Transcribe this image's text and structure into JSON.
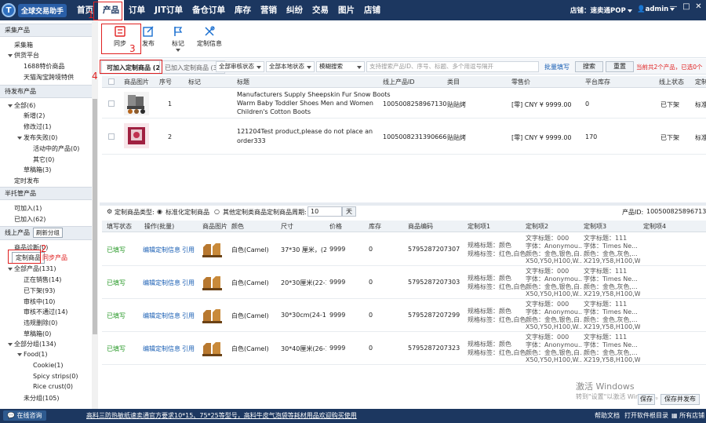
{
  "header": {
    "logo_text": "全球交易助手",
    "logo_letter": "T",
    "nav": [
      "首页",
      "产品",
      "订单",
      "JIT订单",
      "备仓订单",
      "库存",
      "营销",
      "纠纷",
      "交易",
      "图片",
      "店铺"
    ],
    "store_label": "店铺：",
    "store_name": "速卖通POP",
    "user": "admin",
    "win_min": "—",
    "win_max": "□",
    "win_close": "✕"
  },
  "sidebar": {
    "sec1": "采集产品",
    "collect": "采集箱",
    "supply": "供货平台",
    "s1688": "1688特价商品",
    "tmall": "天猫淘宝跨境特供",
    "sec2": "待发布产品",
    "all": "全部(6)",
    "new": "新增(2)",
    "modified": "修改过(1)",
    "pubfail": "发布失败(0)",
    "active_fail": "活动中的产品(0)",
    "other": "其它(0)",
    "draft": "草稿箱(3)",
    "scheduled": "定时发布",
    "sec3": "半托管产品",
    "can_join": "可加入(1)",
    "joined": "已加入(62)",
    "sec4": "线上产品",
    "refresh": "刷新分组",
    "diagnose": "商品诊断(0)",
    "custom": "定制商品",
    "sync_prod": "同步产品",
    "allprod": "全部产品(131)",
    "onsale": "正在销售(14)",
    "offshelf": "已下架(93)",
    "reviewing": "审核中(10)",
    "rejected": "审核不通过(14)",
    "illegal": "违规删除(0)",
    "draft2": "草稿箱(0)",
    "allgroup": "全部分组(134)",
    "food": "Food(1)",
    "cookie": "Cookie(1)",
    "spicy": "Spicy strips(0)",
    "rice": "Rice crust(0)",
    "ungrouped": "未分组(105)"
  },
  "toolbar": {
    "sync": "同步",
    "publish": "发布",
    "mark": "标记",
    "custom_info": "定制信息"
  },
  "filters": {
    "tab1": "可加入定制商品 (2)",
    "tab2": "已加入定制商品 (3)",
    "audit": "全部审核状态",
    "local": "全部本地状态",
    "fuzzy": "模糊搜索",
    "search_placeholder": "支持搜索产品ID、序号、标题、多个用逗号隔开",
    "batch": "批量填写",
    "search_btn": "搜索",
    "reset_btn": "重置",
    "count_note": "当前共2个产品，已选0个"
  },
  "top_table": {
    "headers": [
      "商品图片",
      "序号",
      "标记",
      "标题",
      "线上产品ID",
      "类目",
      "零售价",
      "平台库存",
      "线上状态",
      "定制"
    ],
    "rows": [
      {
        "idx": "1",
        "title1": "Manufacturers Supply Sheepskin Fur Snow Boots",
        "title2": "Warm Baby Toddler Shoes Men and Women",
        "title3": "Children's Cotton Boots",
        "pid": "1005008258967130",
        "cat": "贴贴烤",
        "price": "[零] CNY ¥ 9999.00",
        "stock": "0",
        "status": "已下架",
        "ctype": "标准"
      },
      {
        "idx": "2",
        "title1": "121204Test product,please do not place an",
        "title2": "order333",
        "title3": "",
        "pid": "1005008231390666",
        "cat": "贴贴烤",
        "price": "[零] CNY ¥ 9999.00",
        "stock": "170",
        "status": "已下架",
        "ctype": "标准"
      }
    ]
  },
  "custom_bar": {
    "type_label": "定制商品类型:",
    "opt1": "标准化定制商品",
    "opt2": "其他定制类商品",
    "period_label": "定制商品周期:",
    "period_value": "10",
    "period_unit": "天",
    "pid_label": "产品ID:",
    "pid_value": "1005008258967130"
  },
  "bottom_table": {
    "headers": [
      "填写状态",
      "操作(批量)",
      "商品图片",
      "颜色",
      "尺寸",
      "价格",
      "库存",
      "商品编码",
      "定制项1",
      "定制项2",
      "定制项3",
      "定制项4"
    ],
    "rows": [
      {
        "status": "已填写",
        "edit": "编辑定制信息",
        "ref": "引用",
        "color": "白色(Camel)",
        "size": "37*30 厘米，(20",
        "price": "9999",
        "stock": "0",
        "code": "5795287207307"
      },
      {
        "status": "已填写",
        "edit": "编辑定制信息",
        "ref": "引用",
        "color": "白色(Camel)",
        "size": "20*30厘米(22-1",
        "price": "9999",
        "stock": "0",
        "code": "5795287207303"
      },
      {
        "status": "已填写",
        "edit": "编辑定制信息",
        "ref": "引用",
        "color": "白色(Camel)",
        "size": "30*30cm(24-17",
        "price": "9999",
        "stock": "0",
        "code": "5795287207299"
      },
      {
        "status": "已填写",
        "edit": "编辑定制信息",
        "ref": "引用",
        "color": "白色(Camel)",
        "size": "30*40厘米(26-1",
        "price": "9999",
        "stock": "0",
        "code": "5795287207323"
      }
    ],
    "c1a": "规格标题：颜色",
    "c1b": "规格标签：红色,白色",
    "c2a": "文字标题：000",
    "c2b": "字体：Anonymou...",
    "c2c": "颜色：金色,银色,白...",
    "c2d": "X50,Y50,H100,W...",
    "c3a": "文字标题：111",
    "c3b": "字体：Times Ne...",
    "c3c": "颜色：金色,灰色,...",
    "c3d": "X219,Y58,H100,W..."
  },
  "watermark": {
    "line1": "激活 Windows",
    "line2": "转到\"设置\"以激活 Windows。"
  },
  "actions": {
    "save": "保存",
    "save_publish": "保存并发布"
  },
  "status": {
    "online": "在线咨询",
    "ad": "高料三防热敏纸速卖通官方要求10*15、75*25等型号，高料牛皮气泡袋等耗材用品欢迎购买使用",
    "help": "帮助文档",
    "open_dir": "打开软件根目录",
    "all_stores": "所有店铺"
  },
  "annotations": [
    "1",
    "2",
    "3",
    "4"
  ],
  "colors": {
    "header": "#1c3760",
    "accent": "#e02020",
    "link": "#1a5fb4",
    "ok": "#2a9a2a"
  }
}
